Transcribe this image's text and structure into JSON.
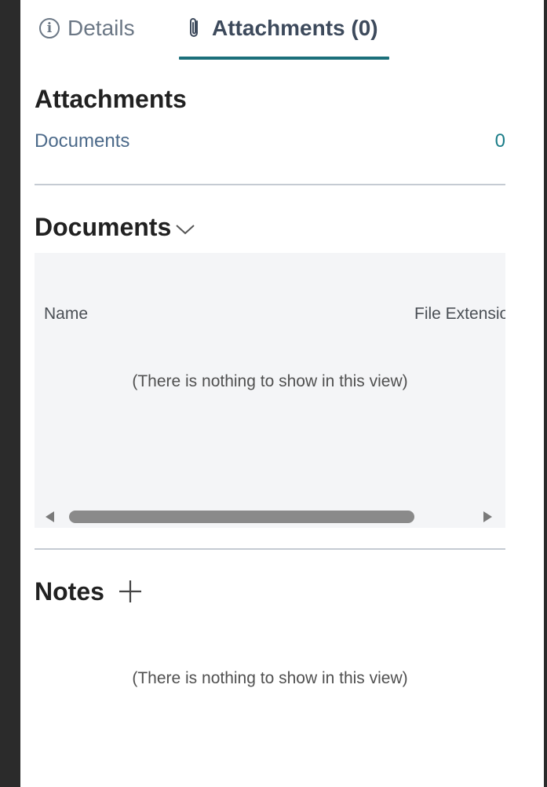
{
  "tabs": [
    {
      "label": "Details",
      "icon": "info-icon"
    },
    {
      "label": "Attachments (0)",
      "icon": "paperclip-icon",
      "active": true
    }
  ],
  "attachments": {
    "title": "Attachments",
    "summary_label": "Documents",
    "summary_count": "0"
  },
  "documents": {
    "title": "Documents",
    "columns": [
      "Name",
      "File Extension"
    ],
    "empty_text": "(There is nothing to show in this view)"
  },
  "notes": {
    "title": "Notes",
    "empty_text": "(There is nothing to show in this view)"
  },
  "colors": {
    "accent": "#1b6f7a",
    "link": "#1b7d88",
    "grid_bg": "#f4f5f7"
  }
}
